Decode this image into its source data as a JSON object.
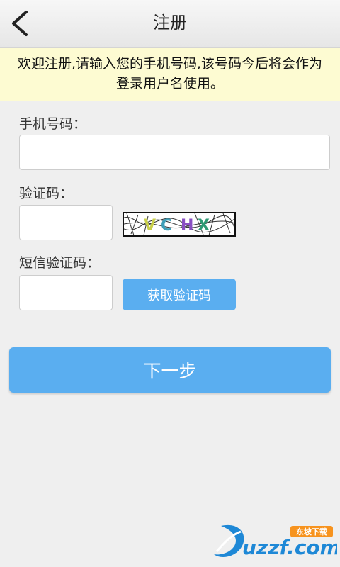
{
  "header": {
    "title": "注册",
    "back_icon": "chevron-left-icon"
  },
  "notice": {
    "line1": "欢迎注册,请输入您的手机号码,该号码今后将会作为",
    "line2": "登录用户名使用。"
  },
  "form": {
    "phone_label": "手机号码：",
    "phone_value": "",
    "captcha_label": "验证码：",
    "captcha_value": "",
    "captcha_text": "VCHX",
    "sms_label": "短信验证码：",
    "sms_value": "",
    "get_code_button": "获取验证码"
  },
  "actions": {
    "next_button": "下一步"
  },
  "watermark": {
    "brand": "uzzf.com",
    "cn_name": "东坡下载"
  },
  "colors": {
    "accent": "#5aaef0",
    "notice_bg": "#fdfbd2",
    "background": "#efefef"
  }
}
